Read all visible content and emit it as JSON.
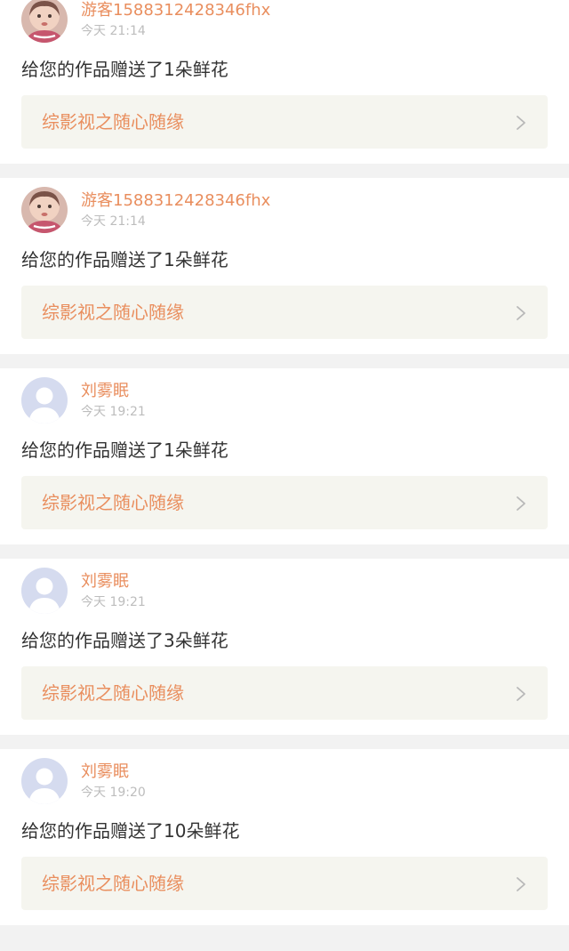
{
  "notifications": [
    {
      "username": "游客1588312428346fhx",
      "time": "今天 21:14",
      "message": "给您的作品赠送了1朵鲜花",
      "work_title": "综影视之随心随缘",
      "avatar": "baby-photo-avatar"
    },
    {
      "username": "游客1588312428346fhx",
      "time": "今天 21:14",
      "message": "给您的作品赠送了1朵鲜花",
      "work_title": "综影视之随心随缘",
      "avatar": "baby-photo-avatar"
    },
    {
      "username": "刘雾眠",
      "time": "今天 19:21",
      "message": "给您的作品赠送了1朵鲜花",
      "work_title": "综影视之随心随缘",
      "avatar": "default-user-avatar"
    },
    {
      "username": "刘雾眠",
      "time": "今天 19:21",
      "message": "给您的作品赠送了3朵鲜花",
      "work_title": "综影视之随心随缘",
      "avatar": "default-user-avatar"
    },
    {
      "username": "刘雾眠",
      "time": "今天 19:20",
      "message": "给您的作品赠送了10朵鲜花",
      "work_title": "综影视之随心随缘",
      "avatar": "default-user-avatar"
    }
  ],
  "icons": {
    "chevron": "chevron-right-icon"
  },
  "colors": {
    "accent": "#e98e5e",
    "card_link_bg": "#f5f5ef",
    "separator": "#f2f2f2",
    "default_avatar": "#d5dbef"
  }
}
